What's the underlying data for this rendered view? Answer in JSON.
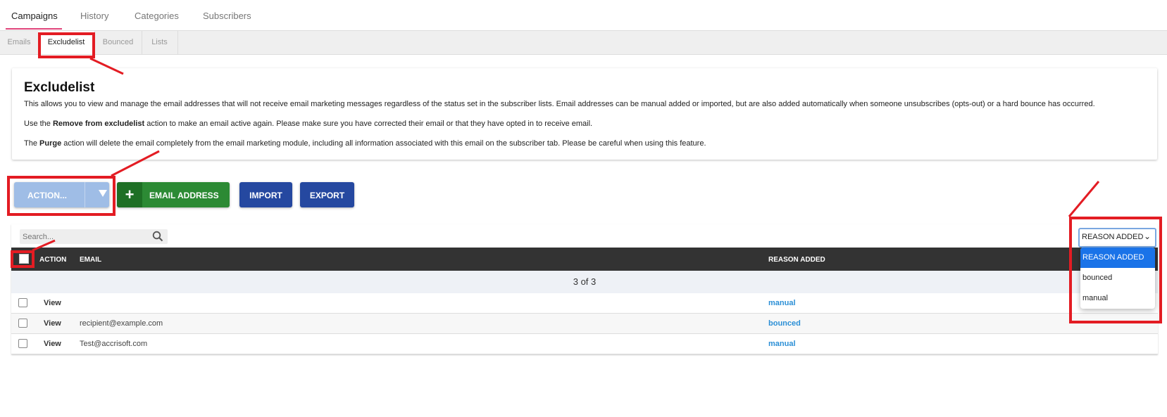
{
  "top_tabs": [
    {
      "label": "Campaigns"
    },
    {
      "label": "History"
    },
    {
      "label": "Categories"
    },
    {
      "label": "Subscribers"
    }
  ],
  "sub_tabs": [
    {
      "label": "Emails"
    },
    {
      "label": "Excludelist"
    },
    {
      "label": "Bounced"
    },
    {
      "label": "Lists"
    }
  ],
  "info": {
    "title": "Excludelist",
    "p1": "This allows you to view and manage the email addresses that will not receive email marketing messages regardless of the status set in the subscriber lists. Email addresses can be manual added or imported, but are also added automatically when someone unsubscribes (opts-out) or a hard bounce has occurred.",
    "p2_pre": "Use the ",
    "p2_bold": "Remove from excludelist",
    "p2_post": " action to make an email active again. Please make sure you have corrected their email or that they have opted in to receive email.",
    "p3_pre": "The ",
    "p3_bold": "Purge",
    "p3_post": " action will delete the email completely from the email marketing module, including all information associated with this email on the subscriber tab. Please be careful when using this feature."
  },
  "toolbar": {
    "action_label": "ACTION...",
    "email_plus": "+",
    "email_label": "EMAIL ADDRESS",
    "import_label": "IMPORT",
    "export_label": "EXPORT"
  },
  "search": {
    "placeholder": "Search..."
  },
  "table": {
    "headers": {
      "action": "ACTION",
      "email": "EMAIL",
      "reason": "REASON ADDED"
    },
    "count": "3 of 3",
    "rows": [
      {
        "view": "View",
        "email": "",
        "reason": "manual"
      },
      {
        "view": "View",
        "email": "recipient@example.com",
        "reason": "bounced"
      },
      {
        "view": "View",
        "email": "Test@accrisoft.com",
        "reason": "manual"
      }
    ]
  },
  "filter": {
    "selected": "REASON ADDED",
    "options": [
      "REASON ADDED",
      "bounced",
      "manual"
    ]
  },
  "colors": {
    "accent": "#e0457b",
    "link": "#2b8fd6",
    "green": "#2c8a34",
    "navy": "#2548a0",
    "annotation": "#e31c23"
  }
}
